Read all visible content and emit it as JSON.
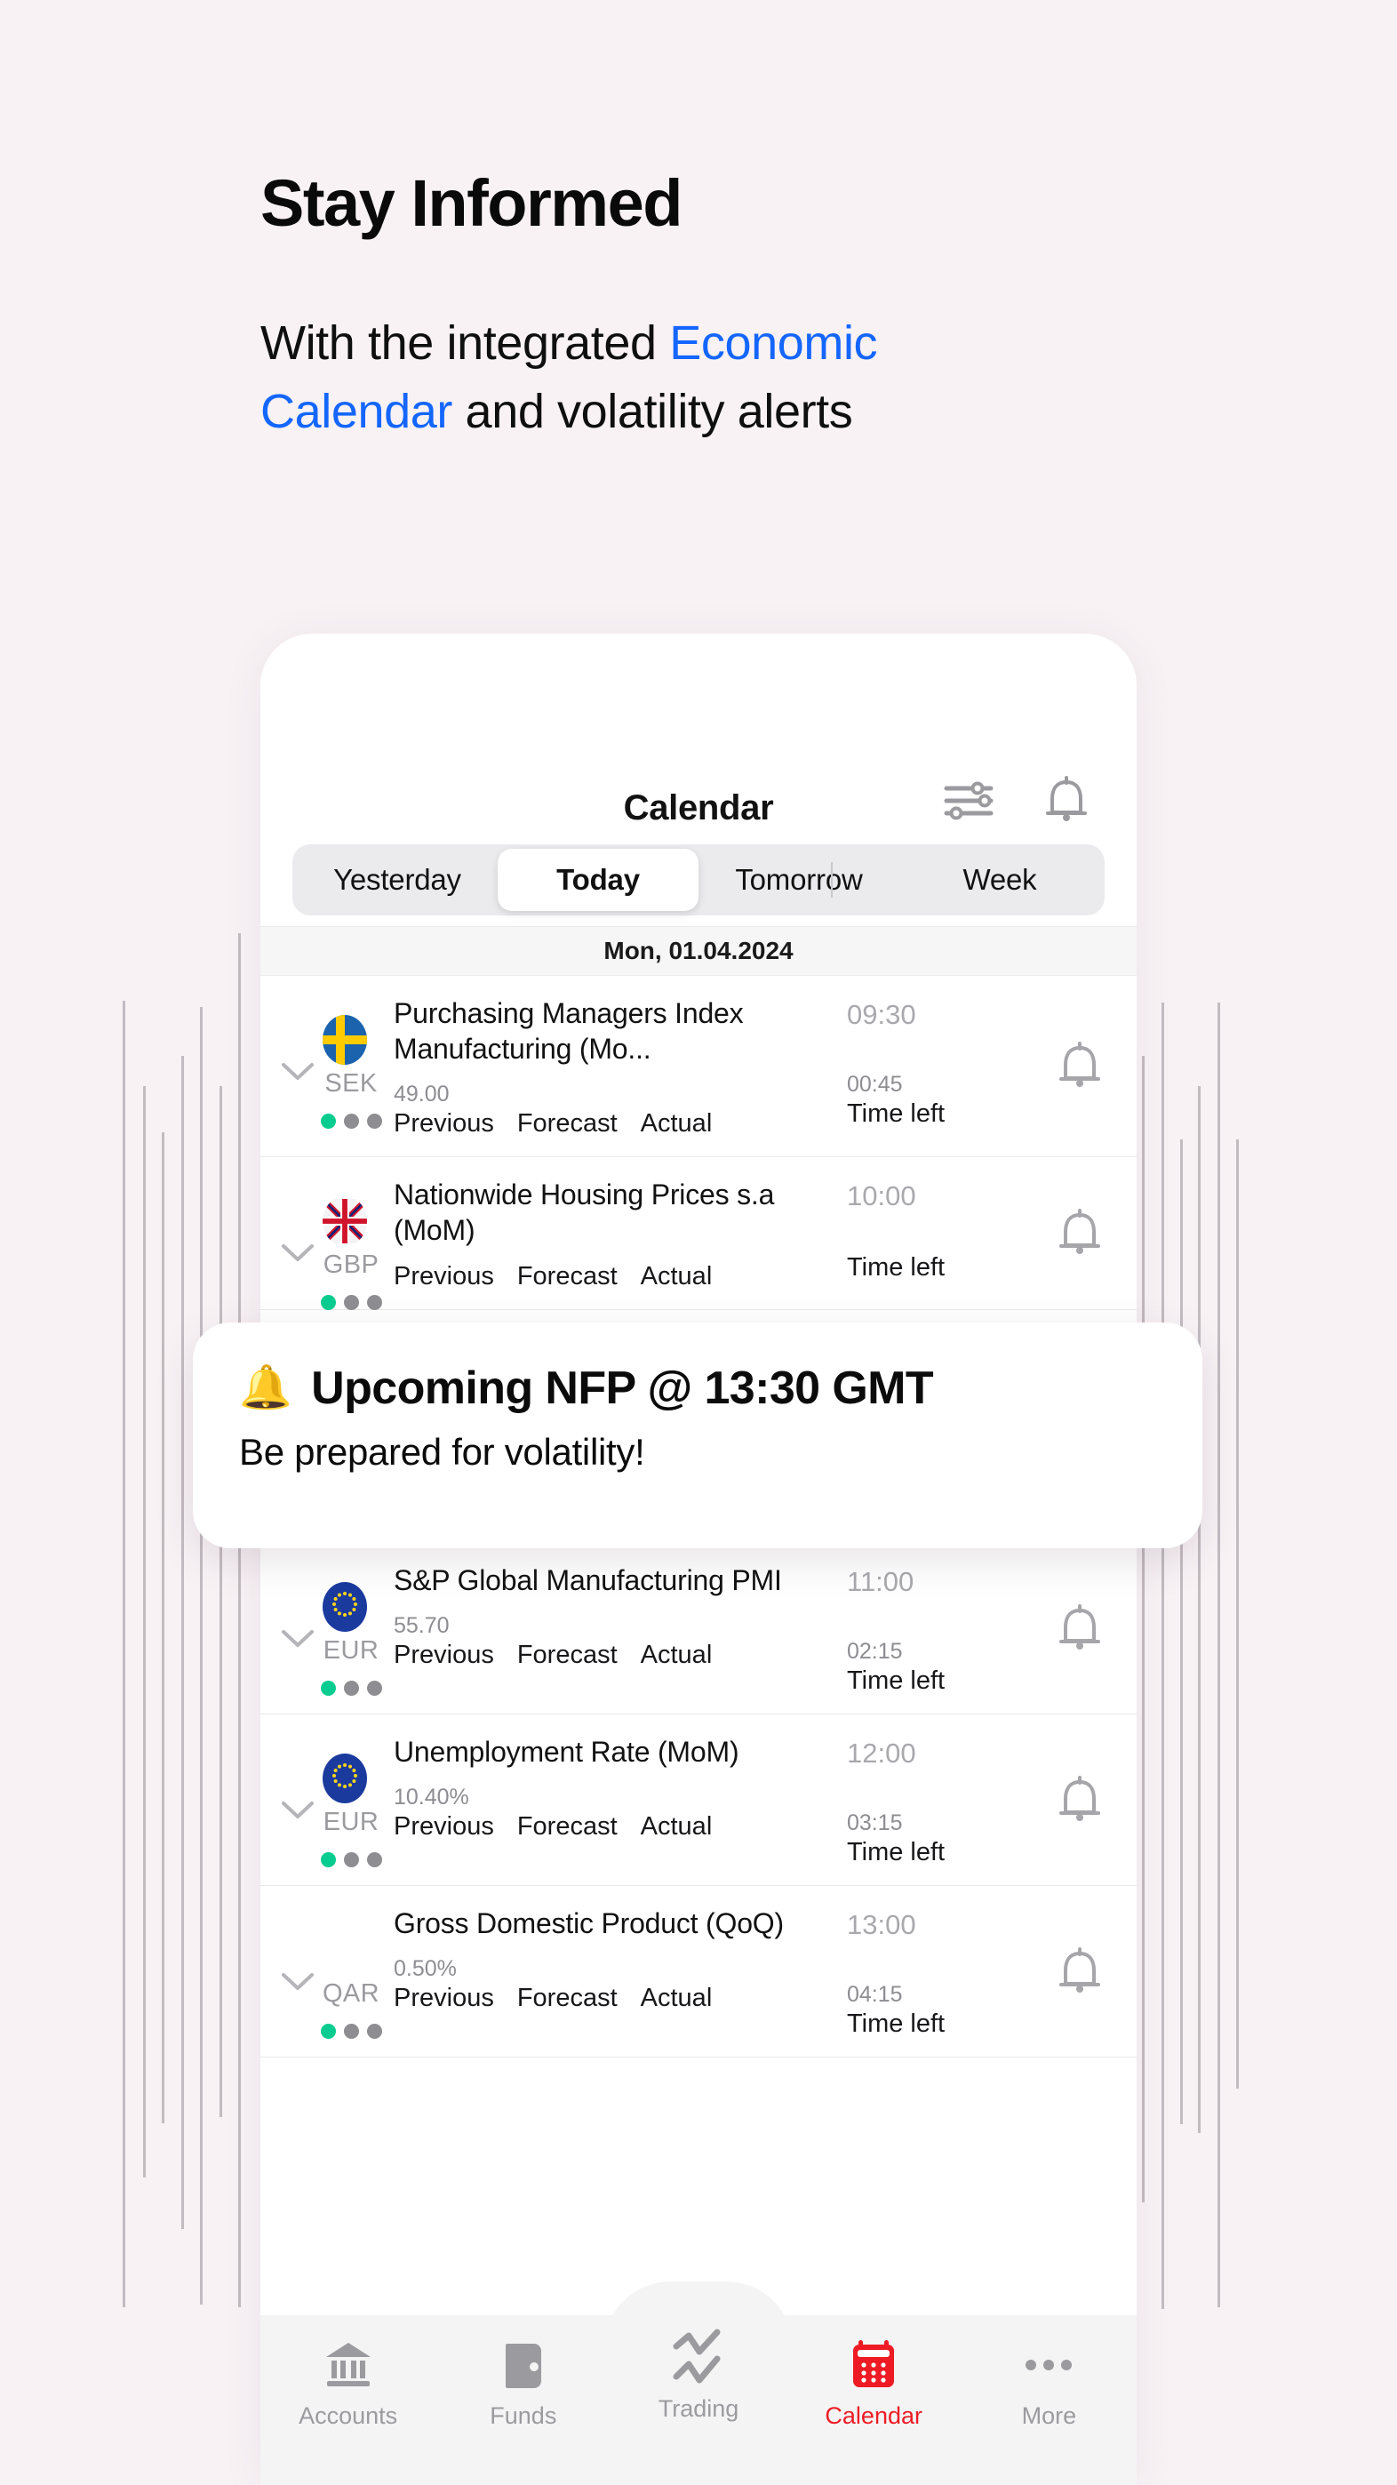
{
  "promo": {
    "headline": "Stay Informed",
    "sub_part1": "With the integrated ",
    "sub_accent": "Economic Calendar",
    "sub_part2": " and volatility alerts",
    "accent_color": "#1466ff",
    "background_color": "#f8f2f5"
  },
  "app": {
    "title": "Calendar",
    "header_icons": [
      {
        "name": "filter-sliders-icon"
      },
      {
        "name": "bell-icon"
      }
    ],
    "tabs": [
      {
        "label": "Yesterday",
        "active": false
      },
      {
        "label": "Today",
        "active": true
      },
      {
        "label": "Tomorrow",
        "active": false
      },
      {
        "label": "Week",
        "active": false
      }
    ],
    "date_header": "Mon, 01.04.2024",
    "column_labels": {
      "previous": "Previous",
      "forecast": "Forecast",
      "actual": "Actual",
      "time_left": "Time left"
    },
    "events": [
      {
        "currency": "SEK",
        "flag": "sweden",
        "title": "Purchasing Managers Index Manufacturing (Mo...",
        "previous_value": "49.00",
        "time": "09:30",
        "time_left": "00:45",
        "impact": 1
      },
      {
        "currency": "GBP",
        "flag": "uk",
        "title": "Nationwide Housing Prices s.a (MoM)",
        "previous_value": "",
        "time": "10:00",
        "time_left": "",
        "impact": 1
      },
      {
        "currency": "",
        "flag": "none",
        "title": "",
        "previous_value": "",
        "time": "",
        "time_left": "",
        "impact": 1
      },
      {
        "currency": "EUR",
        "flag": "eu",
        "title": "S&P Global Manufacturing PMI",
        "previous_value": "55.70",
        "time": "11:00",
        "time_left": "02:15",
        "impact": 1
      },
      {
        "currency": "EUR",
        "flag": "eu",
        "title": "Unemployment Rate (MoM)",
        "previous_value": "10.40%",
        "time": "12:00",
        "time_left": "03:15",
        "impact": 1
      },
      {
        "currency": "QAR",
        "flag": "none",
        "title": "Gross Domestic Product (QoQ)",
        "previous_value": "0.50%",
        "time": "13:00",
        "time_left": "04:15",
        "impact": 1
      }
    ],
    "toast": {
      "emoji": "🔔",
      "title": "Upcoming NFP @ 13:30 GMT",
      "subtitle": "Be prepared for volatility!"
    },
    "bottom_nav": {
      "active_color": "#ee1b24",
      "items": [
        {
          "label": "Accounts",
          "icon": "bank-icon",
          "active": false
        },
        {
          "label": "Funds",
          "icon": "wallet-icon",
          "active": false
        },
        {
          "label": "Trading",
          "icon": "chart-line-icon",
          "active": false
        },
        {
          "label": "Calendar",
          "icon": "calendar-icon",
          "active": true
        },
        {
          "label": "More",
          "icon": "ellipsis-icon",
          "active": false
        }
      ]
    }
  }
}
